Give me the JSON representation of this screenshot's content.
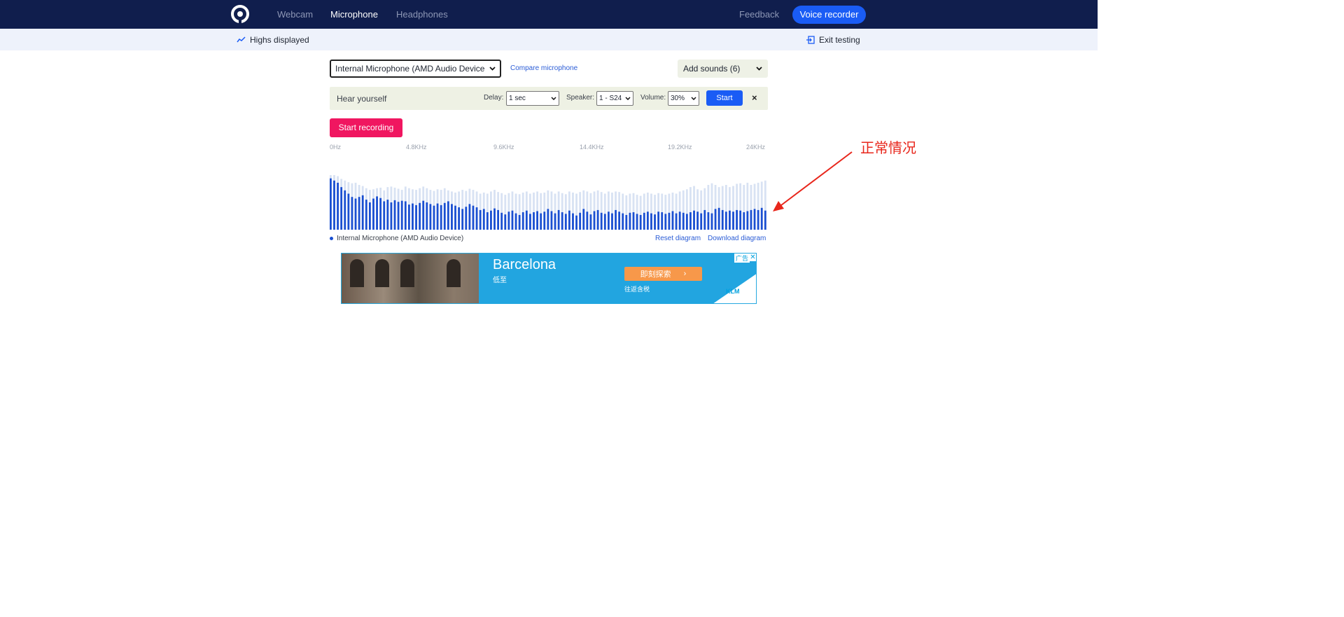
{
  "nav": {
    "links": [
      "Webcam",
      "Microphone",
      "Headphones"
    ],
    "active": "Microphone",
    "feedback": "Feedback",
    "voice_recorder": "Voice recorder"
  },
  "subbar": {
    "highs": "Highs displayed",
    "exit": "Exit testing"
  },
  "controls": {
    "microphone_select": "Internal Microphone (AMD Audio Device",
    "compare": "Compare microphone",
    "add_sounds": "Add sounds (6)"
  },
  "hear": {
    "label": "Hear yourself",
    "delay_label": "Delay:",
    "delay_value": "1 sec",
    "speaker_label": "Speaker:",
    "speaker_value": "1 - S24",
    "volume_label": "Volume:",
    "volume_value": "30%",
    "start": "Start",
    "close": "×"
  },
  "recording": {
    "start": "Start recording"
  },
  "spectrum": {
    "ticks": [
      "0Hz",
      "4.8KHz",
      "9.6KHz",
      "14.4KHz",
      "19.2KHz",
      "24KHz"
    ],
    "legend": "Internal Microphone (AMD Audio Device)",
    "reset": "Reset diagram",
    "download": "Download diagram"
  },
  "chart_data": {
    "type": "bar",
    "x_range": [
      "0Hz",
      "24KHz"
    ],
    "series": [
      {
        "values": [
          0.94,
          0.9,
          0.86,
          0.78,
          0.72,
          0.66,
          0.6,
          0.57,
          0.6,
          0.63,
          0.55,
          0.5,
          0.57,
          0.61,
          0.58,
          0.52,
          0.55,
          0.5,
          0.54,
          0.51,
          0.53,
          0.52,
          0.46,
          0.48,
          0.45,
          0.49,
          0.53,
          0.5,
          0.47,
          0.44,
          0.48,
          0.45,
          0.49,
          0.52,
          0.47,
          0.44,
          0.41,
          0.38,
          0.42,
          0.47,
          0.44,
          0.41,
          0.36,
          0.38,
          0.32,
          0.35,
          0.39,
          0.36,
          0.31,
          0.28,
          0.33,
          0.35,
          0.3,
          0.27,
          0.32,
          0.35,
          0.29,
          0.32,
          0.34,
          0.3,
          0.33,
          0.38,
          0.34,
          0.3,
          0.36,
          0.32,
          0.29,
          0.35,
          0.3,
          0.26,
          0.31,
          0.38,
          0.33,
          0.28,
          0.34,
          0.36,
          0.31,
          0.29,
          0.33,
          0.3,
          0.36,
          0.33,
          0.3,
          0.27,
          0.31,
          0.32,
          0.29,
          0.27,
          0.31,
          0.33,
          0.3,
          0.28,
          0.33,
          0.32,
          0.29,
          0.31,
          0.34,
          0.3,
          0.33,
          0.31,
          0.29,
          0.32,
          0.35,
          0.33,
          0.3,
          0.36,
          0.32,
          0.3,
          0.38,
          0.4,
          0.36,
          0.33,
          0.35,
          0.33,
          0.36,
          0.35,
          0.32,
          0.34,
          0.36,
          0.38,
          0.36,
          0.4,
          0.35
        ]
      },
      {
        "values": [
          1.0,
          1.0,
          0.98,
          0.93,
          0.9,
          0.87,
          0.85,
          0.86,
          0.82,
          0.8,
          0.76,
          0.73,
          0.74,
          0.76,
          0.77,
          0.72,
          0.78,
          0.79,
          0.77,
          0.75,
          0.73,
          0.79,
          0.76,
          0.74,
          0.73,
          0.76,
          0.79,
          0.76,
          0.73,
          0.71,
          0.74,
          0.73,
          0.76,
          0.72,
          0.7,
          0.68,
          0.7,
          0.73,
          0.71,
          0.75,
          0.73,
          0.7,
          0.66,
          0.68,
          0.66,
          0.7,
          0.73,
          0.69,
          0.67,
          0.64,
          0.67,
          0.7,
          0.66,
          0.65,
          0.68,
          0.7,
          0.66,
          0.68,
          0.7,
          0.67,
          0.68,
          0.72,
          0.7,
          0.66,
          0.7,
          0.67,
          0.65,
          0.7,
          0.68,
          0.66,
          0.69,
          0.72,
          0.7,
          0.67,
          0.7,
          0.72,
          0.69,
          0.66,
          0.7,
          0.68,
          0.7,
          0.69,
          0.66,
          0.63,
          0.66,
          0.67,
          0.64,
          0.62,
          0.66,
          0.68,
          0.66,
          0.64,
          0.67,
          0.66,
          0.64,
          0.66,
          0.68,
          0.66,
          0.7,
          0.72,
          0.74,
          0.78,
          0.8,
          0.74,
          0.72,
          0.76,
          0.82,
          0.85,
          0.82,
          0.78,
          0.8,
          0.82,
          0.78,
          0.8,
          0.84,
          0.85,
          0.82,
          0.86,
          0.82,
          0.84,
          0.86,
          0.88,
          0.9
        ]
      }
    ]
  },
  "ad": {
    "city": "Barcelona",
    "low": "低至",
    "cta": "即刻探索",
    "cta_arrow": "›",
    "tax": "往返含税",
    "brand": "KLM",
    "tag": "广告",
    "close": "✕",
    "accent": "#22a5e0"
  },
  "annotation": {
    "text": "正常情况",
    "color": "#e8261b"
  },
  "colors": {
    "nav_bg": "#101e4d",
    "primary": "#1a5cf5",
    "record": "#f01660",
    "bar": "#1a4fd1",
    "bar_peak": "#d8e2f3"
  }
}
